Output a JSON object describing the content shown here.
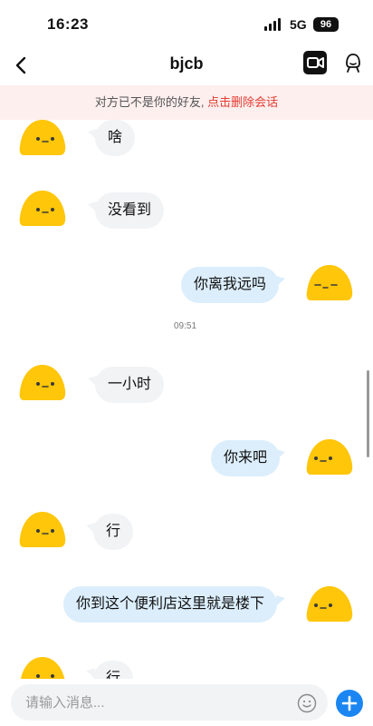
{
  "status": {
    "time": "16:23",
    "network": "5G",
    "battery": "96"
  },
  "nav": {
    "title": "bjcb"
  },
  "banner": {
    "text": "对方已不是你的好友, ",
    "link": "点击删除会话"
  },
  "messages": [
    {
      "text": "啥"
    },
    {
      "text": "没看到"
    },
    {
      "text": "你离我远吗"
    },
    {
      "text": "一小时"
    },
    {
      "text": "你来吧"
    },
    {
      "text": "行"
    },
    {
      "text": "你到这个便利店这里就是楼下"
    },
    {
      "text": "行"
    }
  ],
  "timestamp": "09:51",
  "input": {
    "placeholder": "请输入消息..."
  },
  "icons": {
    "back": "chevron-left-icon",
    "video": "video-call-icon",
    "profile": "profile-icon",
    "emoji": "emoji-icon",
    "plus": "plus-icon"
  },
  "colors": {
    "accent": "#1b86f2",
    "warning": "#e63b32",
    "outgoing_bubble": "#dceefc",
    "incoming_bubble": "#f2f3f5",
    "avatar": "#ffc60a"
  }
}
